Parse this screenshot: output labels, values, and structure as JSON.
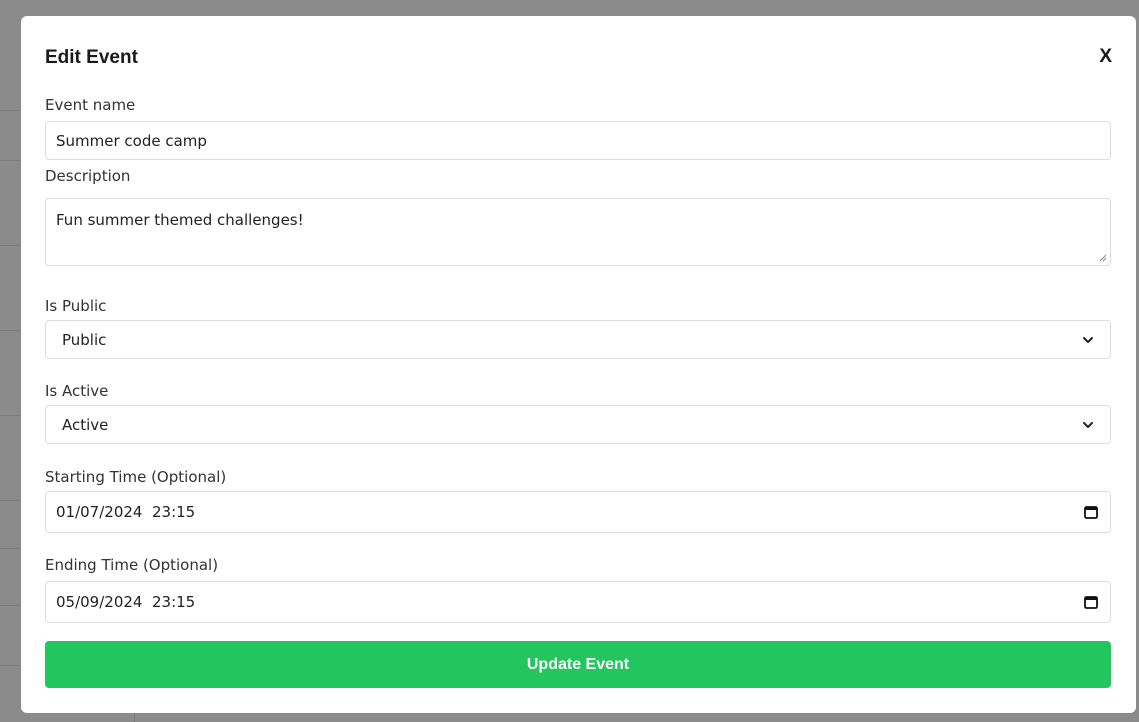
{
  "modal": {
    "title": "Edit Event",
    "close_label": "X"
  },
  "form": {
    "event_name": {
      "label": "Event name",
      "value": "Summer code camp"
    },
    "description": {
      "label": "Description",
      "value": "Fun summer themed challenges!"
    },
    "is_public": {
      "label": "Is Public",
      "selected": "Public"
    },
    "is_active": {
      "label": "Is Active",
      "selected": "Active"
    },
    "starting_time": {
      "label": "Starting Time (Optional)",
      "value": "01/07/2024  23:15"
    },
    "ending_time": {
      "label": "Ending Time (Optional)",
      "value": "05/09/2024  23:15"
    },
    "submit_label": "Update Event"
  },
  "colors": {
    "submit_button": "#22c55e",
    "overlay": "#8b8b8b"
  },
  "icons": {
    "close": "close-icon",
    "select_arrow": "chevron-down-icon",
    "date_picker": "calendar-icon",
    "textarea_resize": "resize-grip-icon"
  }
}
